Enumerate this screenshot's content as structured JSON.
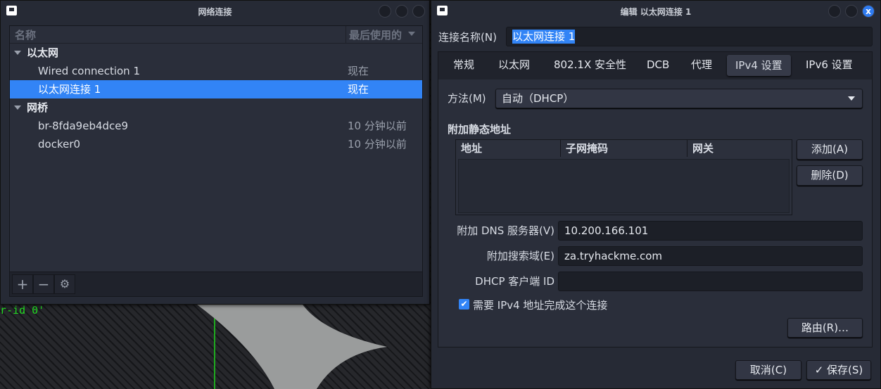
{
  "background": {
    "terminal_text": "r-id 0'"
  },
  "connections_window": {
    "title": "网络连接",
    "columns": {
      "name": "名称",
      "last_used": "最后使用的"
    },
    "groups": [
      {
        "label": "以太网",
        "items": [
          {
            "name": "Wired connection 1",
            "last_used": "现在"
          },
          {
            "name": "以太网连接 1",
            "last_used": "现在",
            "selected": true
          }
        ]
      },
      {
        "label": "网桥",
        "items": [
          {
            "name": "br-8fda9eb4dce9",
            "last_used": "10 分钟以前"
          },
          {
            "name": "docker0",
            "last_used": "10 分钟以前"
          }
        ]
      }
    ],
    "toolbar": {
      "add": "+",
      "remove": "−",
      "settings": "⚙"
    }
  },
  "editor_window": {
    "title": "编辑 以太网连接 1",
    "close": "x",
    "name_label": "连接名称(N)",
    "name_value": "以太网连接 1",
    "tabs": [
      "常规",
      "以太网",
      "802.1X 安全性",
      "DCB",
      "代理",
      "IPv4 设置",
      "IPv6 设置"
    ],
    "active_tab": "IPv4 设置",
    "method_label": "方法(M)",
    "method_value": "自动（DHCP）",
    "static_title": "附加静态地址",
    "table_columns": [
      "地址",
      "子网掩码",
      "网关"
    ],
    "add_button": "添加(A)",
    "delete_button": "删除(D)",
    "dns_label": "附加 DNS 服务器(V)",
    "dns_value": "10.200.166.101",
    "search_label": "附加搜索域(E)",
    "search_value": "za.tryhackme.com",
    "dhcp_label": "DHCP 客户端 ID",
    "dhcp_value": "",
    "require_ipv4_label": "需要 IPv4 地址完成这个连接",
    "require_ipv4_checked": true,
    "routes_button": "路由(R)…",
    "cancel_button": "取消(C)",
    "save_button": "保存(S)",
    "accent": "#3284f6"
  }
}
